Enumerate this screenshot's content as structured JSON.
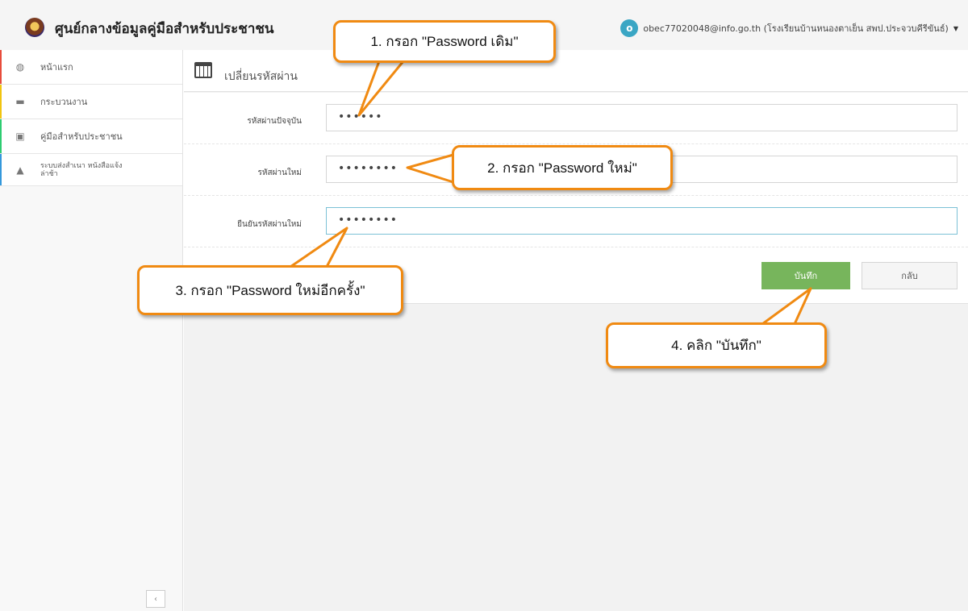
{
  "header": {
    "brand": "ศูนย์กลางข้อมูลคู่มือสำหรับประชาชน",
    "user_avatar_letter": "o",
    "user_label": "obec77020048@info.go.th (โรงเรียนบ้านหนองตาเย็น สพป.ประจวบคีรีขันธ์)"
  },
  "sidebar": {
    "items": [
      {
        "label": "หน้าแรก",
        "icon": "dashboard-icon",
        "accent": "#e74c3c"
      },
      {
        "label": "กระบวนงาน",
        "icon": "folder-icon",
        "accent": "#f1c40f"
      },
      {
        "label": "คู่มือสำหรับประชาชน",
        "icon": "archive-icon",
        "accent": "#2ecc71"
      },
      {
        "label": "ระบบส่งสำเนา หนังสือแจ้งล่าช้า",
        "icon": "warning-icon",
        "accent": "#3498db"
      }
    ],
    "collapse_label": "‹"
  },
  "page": {
    "title": "เปลี่ยนรหัสผ่าน",
    "fields": [
      {
        "label": "รหัสผ่านปัจจุบัน",
        "value": "••••••"
      },
      {
        "label": "รหัสผ่านใหม่",
        "value": "••••••••"
      },
      {
        "label": "ยืนยันรหัสผ่านใหม่",
        "value": "••••••••"
      }
    ],
    "save_label": "บันทึก",
    "back_label": "กลับ"
  },
  "callouts": [
    "1. กรอก \"Password เดิม\"",
    "2. กรอก \"Password ใหม่\"",
    "3. กรอก \"Password ใหม่อีกครั้ง\"",
    "4. คลิก \"บันทึก\""
  ],
  "colors": {
    "accent": "#f08a12",
    "save": "#77b55c",
    "avatar": "#3aa6c4"
  }
}
